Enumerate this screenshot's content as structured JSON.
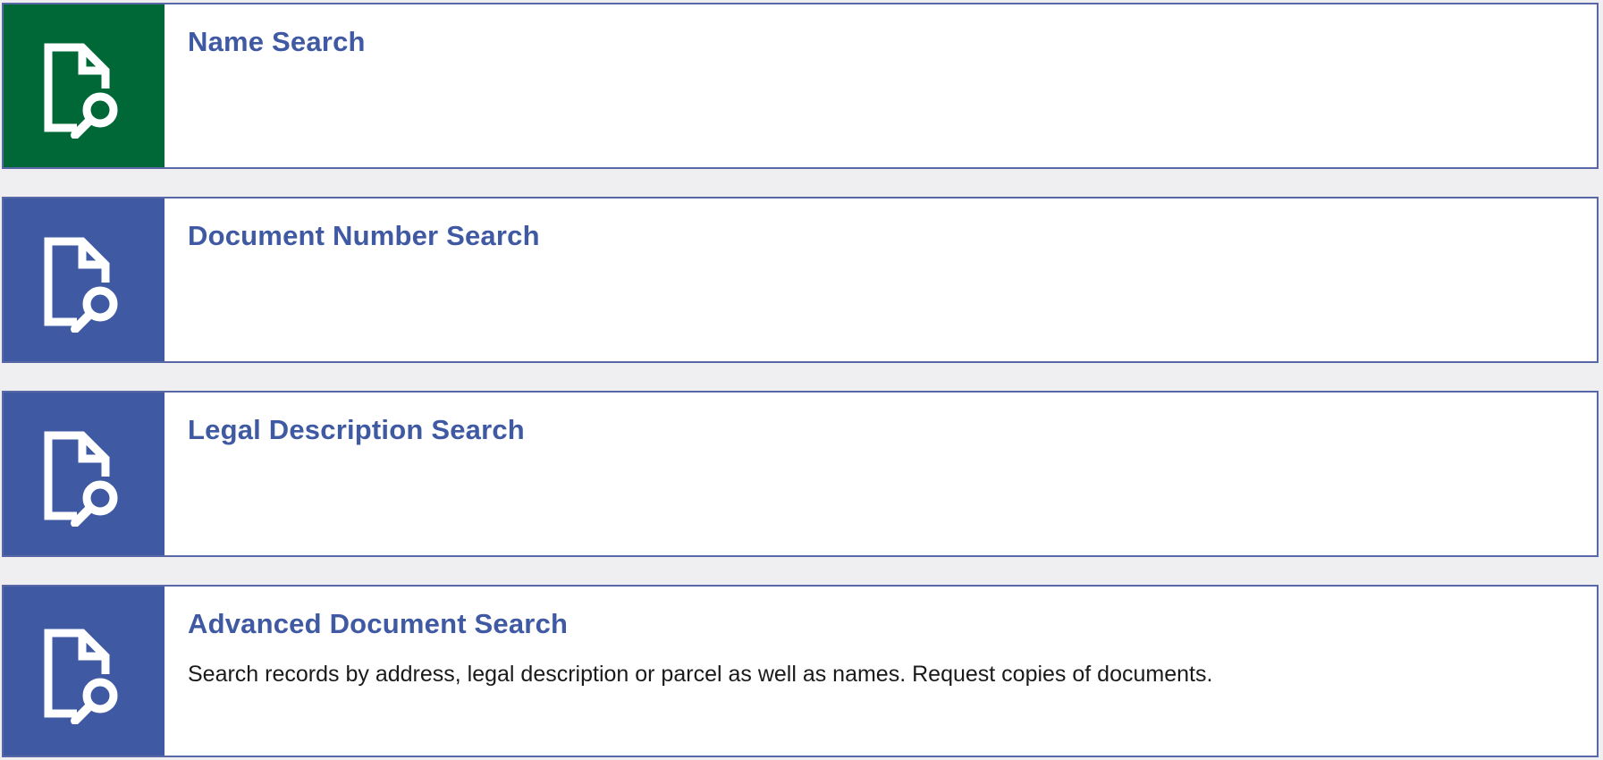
{
  "colors": {
    "active_tile": "#006837",
    "tile": "#3f59a3",
    "title_text": "#3f59a3",
    "border": "#5867a6"
  },
  "cards": [
    {
      "title": "Name Search",
      "description": "",
      "icon": "document-search-icon",
      "active": true
    },
    {
      "title": "Document Number Search",
      "description": "",
      "icon": "document-search-icon",
      "active": false
    },
    {
      "title": "Legal Description Search",
      "description": "",
      "icon": "document-search-icon",
      "active": false
    },
    {
      "title": "Advanced Document Search",
      "description": "Search records by address, legal description or parcel as well as names.  Request copies of documents.",
      "icon": "document-search-icon",
      "active": false
    }
  ]
}
